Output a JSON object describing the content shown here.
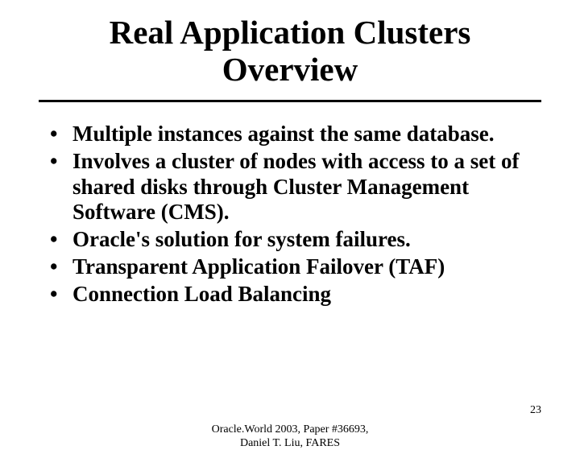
{
  "title_line1": "Real Application Clusters",
  "title_line2": "Overview",
  "bullets": [
    "Multiple instances against the same database.",
    "Involves a cluster of nodes with access to a set of shared disks through Cluster Management Software (CMS).",
    "Oracle's solution for system failures.",
    "Transparent Application Failover (TAF)",
    "Connection Load Balancing"
  ],
  "footer": {
    "center_line1": "Oracle.World 2003, Paper #36693,",
    "center_line2": "Daniel T. Liu, FARES",
    "page": "23"
  }
}
